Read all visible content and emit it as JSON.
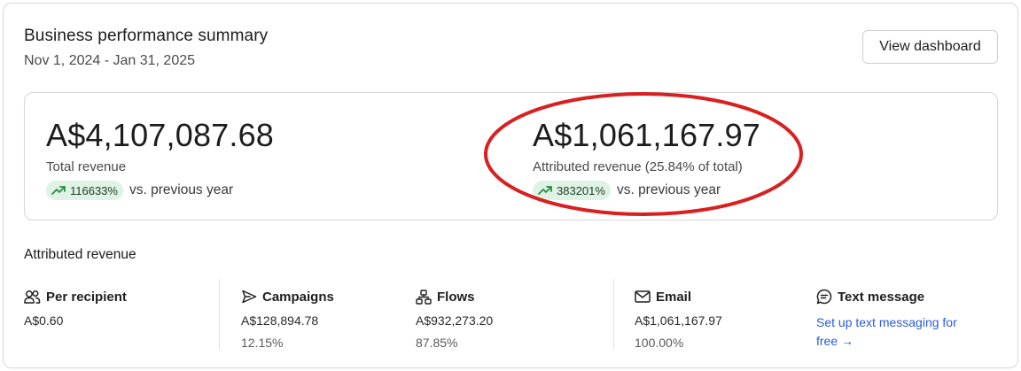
{
  "header": {
    "title": "Business performance summary",
    "date_range": "Nov 1, 2024 - Jan 31, 2025",
    "view_button_label": "View dashboard"
  },
  "metrics": {
    "total": {
      "value": "A$4,107,087.68",
      "label": "Total revenue",
      "change": "116633%",
      "change_direction": "up",
      "comparison": "vs. previous year"
    },
    "attributed": {
      "value": "A$1,061,167.97",
      "label": "Attributed revenue (25.84% of total)",
      "change": "383201%",
      "change_direction": "up",
      "comparison": "vs. previous year",
      "annotation_color": "#d91f1f"
    }
  },
  "attributed_section": {
    "title": "Attributed revenue",
    "per_recipient": {
      "label": "Per recipient",
      "icon": "people-icon",
      "value": "A$0.60"
    },
    "campaigns": {
      "label": "Campaigns",
      "icon": "send-icon",
      "value": "A$128,894.78",
      "percent": "12.15%"
    },
    "flows": {
      "label": "Flows",
      "icon": "flow-icon",
      "value": "A$932,273.20",
      "percent": "87.85%"
    },
    "email": {
      "label": "Email",
      "icon": "envelope-icon",
      "value": "A$1,061,167.97",
      "percent": "100.00%"
    },
    "text_message": {
      "label": "Text message",
      "icon": "chat-icon",
      "link_text": "Set up text messaging for free",
      "link_arrow": "→"
    }
  },
  "colors": {
    "badge_bg": "#dff3e4",
    "trend_up": "#2f8a47",
    "link": "#2a5bd7"
  }
}
